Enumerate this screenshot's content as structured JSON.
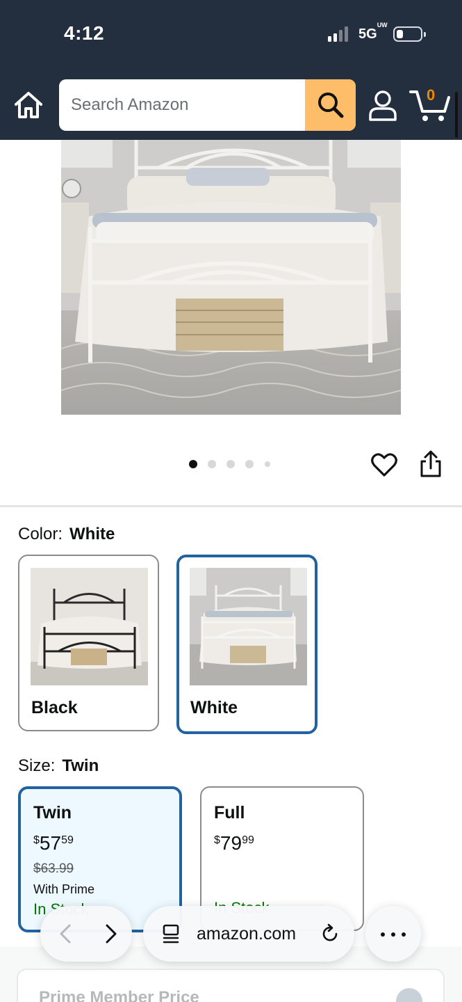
{
  "status_bar": {
    "time": "4:12",
    "network": "5G",
    "network_suffix": "UW"
  },
  "header": {
    "search_placeholder": "Search Amazon",
    "cart_count": "0"
  },
  "gallery": {
    "total_images": 5,
    "active_index": 0
  },
  "color": {
    "label": "Color:",
    "selected": "White",
    "options": [
      {
        "name": "Black",
        "selected": false
      },
      {
        "name": "White",
        "selected": true
      }
    ]
  },
  "size": {
    "label": "Size:",
    "selected": "Twin",
    "options": [
      {
        "name": "Twin",
        "currency": "$",
        "price_whole": "57",
        "price_cents": "59",
        "list_price": "$63.99",
        "prime_note": "With Prime",
        "stock": "In Stock",
        "selected": true
      },
      {
        "name": "Full",
        "currency": "$",
        "price_whole": "79",
        "price_cents": "99",
        "stock": "In Stock",
        "selected": false
      }
    ]
  },
  "prime_section": {
    "title": "Prime Member Price"
  },
  "browser": {
    "url": "amazon.com"
  },
  "colors": {
    "header_bg": "#232f3e",
    "search_button": "#febd69",
    "selected_border": "#2162a1",
    "selected_fill": "#edf8ff",
    "cart_count": "#f08804",
    "in_stock": "#007600"
  }
}
